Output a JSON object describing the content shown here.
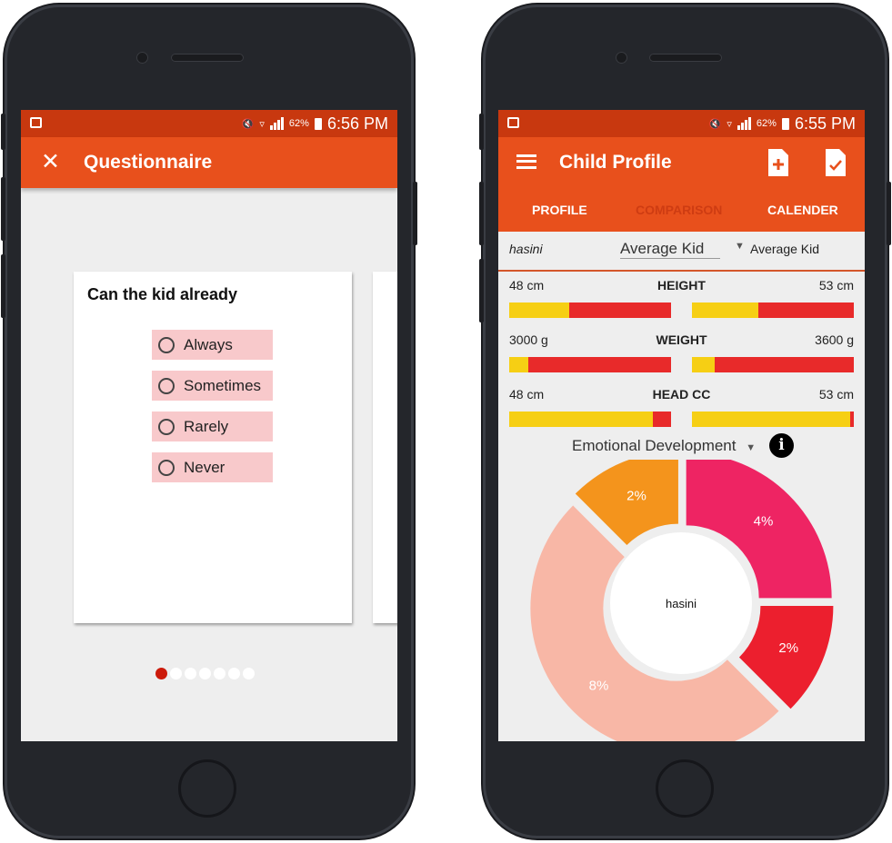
{
  "left_phone": {
    "status": {
      "battery": "62%",
      "time": "6:56 PM"
    },
    "title": "Questionnaire",
    "question": "Can the kid already",
    "options": [
      "Always",
      "Sometimes",
      "Rarely",
      "Never"
    ],
    "pager": {
      "total": 7,
      "active": 1
    }
  },
  "right_phone": {
    "status": {
      "battery": "62%",
      "time": "6:55 PM"
    },
    "title": "Child Profile",
    "tabs": [
      "PROFILE",
      "COMPARISON",
      "CALENDER"
    ],
    "active_tab": "COMPARISON",
    "compare": {
      "left_name": "hasini",
      "middle_select": "Average Kid",
      "right_select": "Average Kid"
    },
    "metrics": [
      {
        "name": "HEIGHT",
        "left_value": "48 cm",
        "right_value": "53 cm",
        "left_fill": 0.37,
        "right_fill": 0.41
      },
      {
        "name": "WEIGHT",
        "left_value": "3000 g",
        "right_value": "3600 g",
        "left_fill": 0.12,
        "right_fill": 0.14
      },
      {
        "name": "HEAD CC",
        "left_value": "48 cm",
        "right_value": "53 cm",
        "left_fill": 0.89,
        "right_fill": 0.98
      }
    ],
    "category_select": "Emotional Development",
    "chart_data": {
      "type": "pie",
      "center_label": "hasini",
      "slices": [
        {
          "label": "4%",
          "value": 4,
          "color": "#ee2463"
        },
        {
          "label": "2%",
          "value": 2,
          "color": "#ec1f2e"
        },
        {
          "label": "8%",
          "value": 8,
          "color": "#f8b7a6"
        },
        {
          "label": "2%",
          "value": 2,
          "color": "#f4941c"
        }
      ]
    }
  },
  "colors": {
    "status_bar": "#c8380f",
    "app_bar": "#e8501c",
    "option_bg": "#f8c9cb",
    "bar_red": "#e82a2a",
    "bar_yellow": "#f6cf14"
  }
}
